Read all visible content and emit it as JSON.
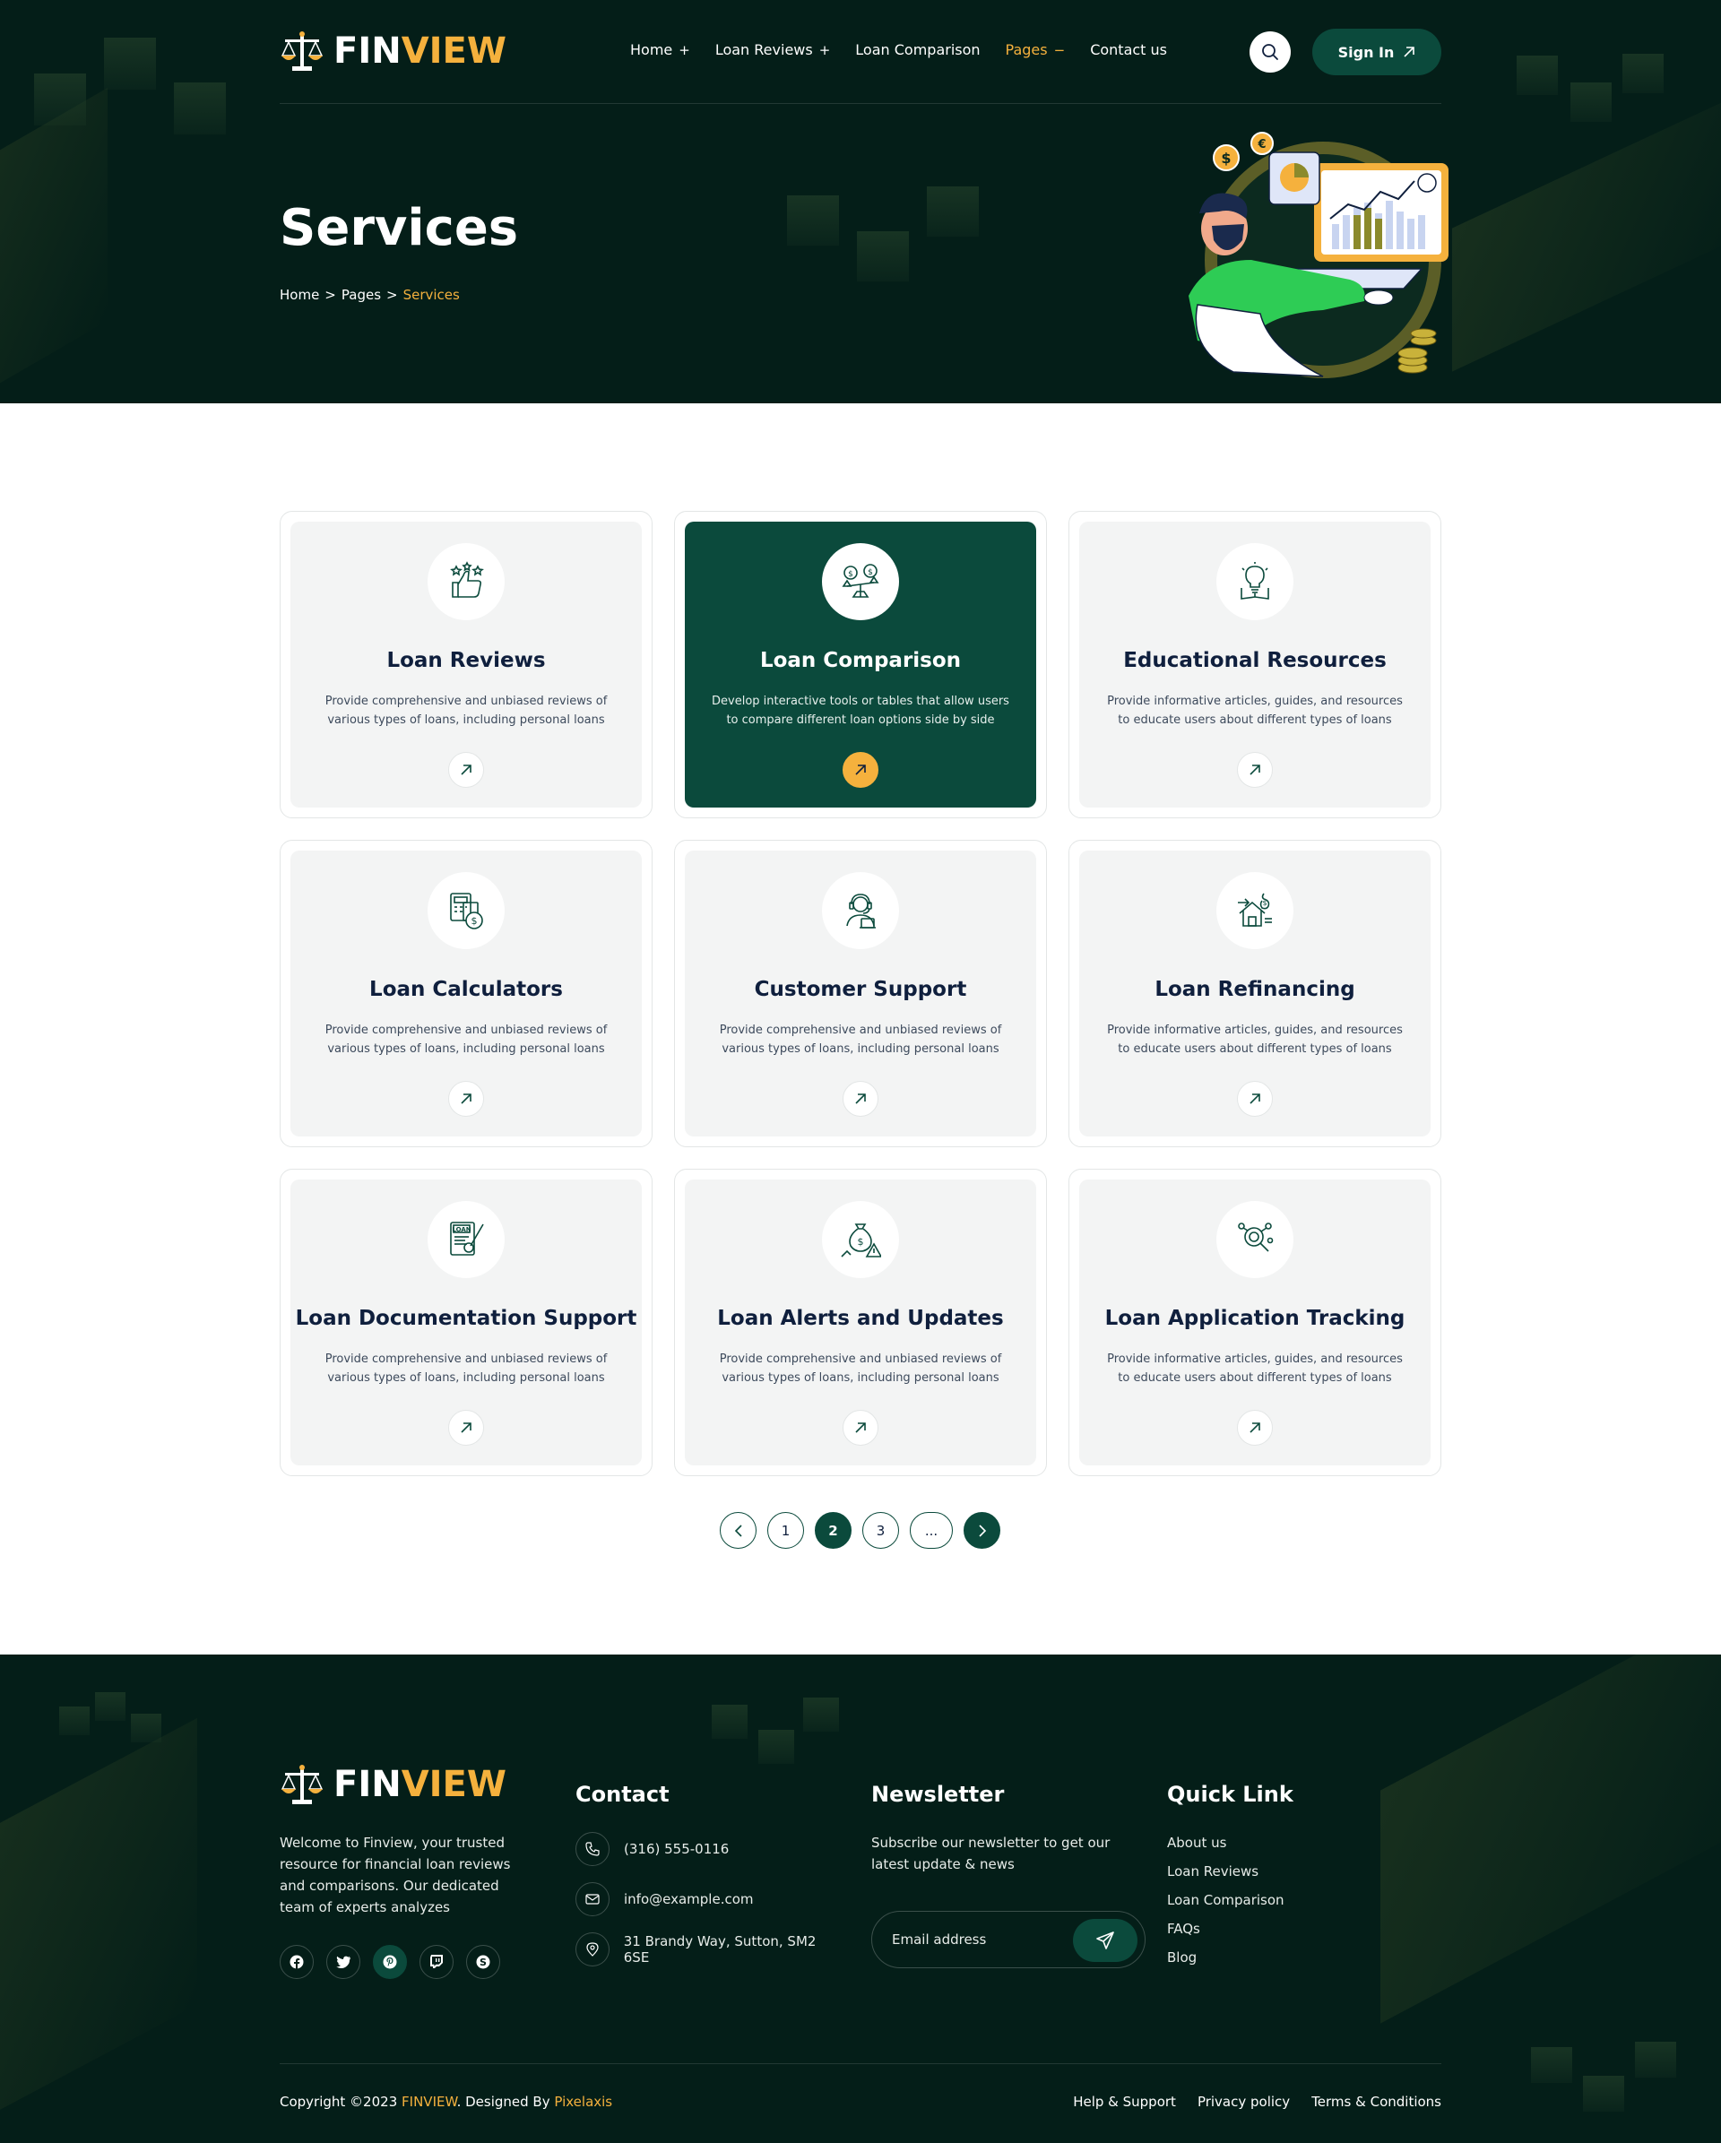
{
  "brand": {
    "name_part1": "FIN",
    "name_part2": "VIEW"
  },
  "nav": {
    "items": [
      {
        "label": "Home",
        "symbol": "+"
      },
      {
        "label": "Loan Reviews",
        "symbol": "+"
      },
      {
        "label": "Loan Comparison",
        "symbol": ""
      },
      {
        "label": "Pages",
        "symbol": "−"
      },
      {
        "label": "Contact us",
        "symbol": ""
      }
    ],
    "active_index": 3,
    "sign_in_label": "Sign In"
  },
  "hero": {
    "title": "Services",
    "breadcrumb": {
      "home": "Home",
      "sep1": ">",
      "pages": "Pages",
      "sep2": ">",
      "current": "Services"
    }
  },
  "services": [
    {
      "title": "Loan Reviews",
      "desc": "Provide comprehensive and unbiased reviews of various types of loans, including personal loans",
      "icon": "thumbs-up-stars-icon"
    },
    {
      "title": "Loan Comparison",
      "desc": "Develop interactive tools or tables that allow users to compare different loan options side by side",
      "icon": "scale-compare-icon"
    },
    {
      "title": "Educational Resources",
      "desc": "Provide informative articles, guides, and resources to educate users about different types of loans",
      "icon": "lightbulb-book-icon"
    },
    {
      "title": "Loan Calculators",
      "desc": "Provide comprehensive and unbiased reviews of various types of loans, including personal loans",
      "icon": "calculator-coin-icon"
    },
    {
      "title": "Customer Support",
      "desc": "Provide comprehensive and unbiased reviews of various types of loans, including personal loans",
      "icon": "headset-agent-icon"
    },
    {
      "title": "Loan Refinancing",
      "desc": "Provide informative articles, guides, and resources to educate users about different types of loans",
      "icon": "house-refinance-icon"
    },
    {
      "title": "Loan Documentation Support",
      "desc": "Provide comprehensive and unbiased reviews of various types of loans, including personal loans",
      "icon": "loan-document-icon"
    },
    {
      "title": "Loan Alerts and Updates",
      "desc": "Provide comprehensive and unbiased reviews of various types of loans, including personal loans",
      "icon": "money-bag-alert-icon"
    },
    {
      "title": "Loan Application Tracking",
      "desc": "Provide informative articles, guides, and resources to educate users about different types of loans",
      "icon": "search-tracking-icon"
    }
  ],
  "featured_index": 1,
  "pagination": {
    "pages": [
      "1",
      "2",
      "3",
      "..."
    ],
    "active": "2"
  },
  "footer": {
    "about": "Welcome to Finview, your trusted resource for financial loan reviews and comparisons. Our dedicated team of experts analyzes",
    "contact_heading": "Contact",
    "phone": "(316) 555-0116",
    "email": "info@example.com",
    "address": "31 Brandy Way, Sutton, SM2 6SE",
    "newsletter_heading": "Newsletter",
    "newsletter_text": "Subscribe our newsletter to get our latest update & news",
    "email_placeholder": "Email address",
    "quick_heading": "Quick Link",
    "quick_links": [
      "About us",
      "Loan Reviews",
      "Loan Comparison",
      "FAQs",
      "Blog"
    ],
    "copyright_prefix": "Copyright ©2023",
    "copyright_brand": "FINVIEW",
    "designed_by": ". Designed By",
    "designer": "Pixelaxis",
    "bottom_links": [
      "Help & Support",
      "Privacy policy",
      "Terms & Conditions"
    ]
  },
  "colors": {
    "dark_bg": "#041e18",
    "primary": "#0b4a3c",
    "accent": "#f5b13d",
    "card_bg": "#f3f4f4"
  }
}
